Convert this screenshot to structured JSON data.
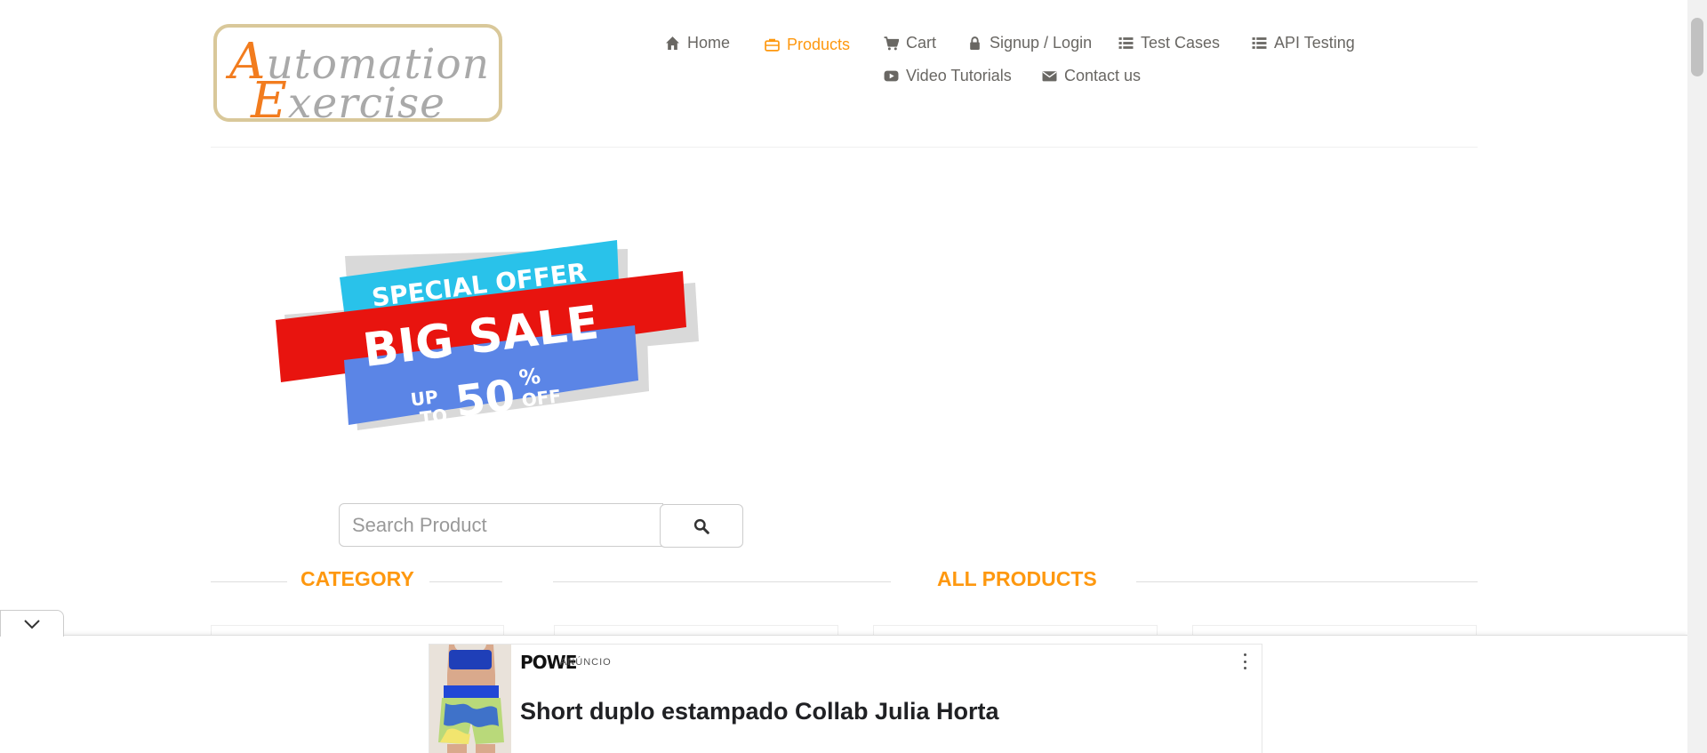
{
  "logo": {
    "line1_first": "A",
    "line1_rest": "utomation",
    "line2_first": "E",
    "line2_rest": "xercise"
  },
  "nav": [
    {
      "label": "Home",
      "icon": "home-icon",
      "active": false
    },
    {
      "label": "Products",
      "icon": "briefcase-icon",
      "active": true
    },
    {
      "label": "Cart",
      "icon": "cart-icon",
      "active": false
    },
    {
      "label": "Signup / Login",
      "icon": "lock-icon",
      "active": false
    },
    {
      "label": "Test Cases",
      "icon": "list-icon",
      "active": false
    },
    {
      "label": "API Testing",
      "icon": "list-icon",
      "active": false
    },
    {
      "label": "Video Tutorials",
      "icon": "youtube-icon",
      "active": false
    },
    {
      "label": "Contact us",
      "icon": "envelope-icon",
      "active": false
    }
  ],
  "banner": {
    "line1": "SPECIAL OFFER",
    "line2": "BIG SALE",
    "up": "UP",
    "to": "TO",
    "percent_value": "50",
    "percent_sign": "%",
    "off": "OFF"
  },
  "search": {
    "placeholder": "Search Product",
    "value": ""
  },
  "sections": {
    "category": "CATEGORY",
    "all_products": "ALL PRODUCTS"
  },
  "ad": {
    "brand": "POWE",
    "label": "ANÚNCIO",
    "title": "Short duplo estampado Collab Julia Horta"
  },
  "colors": {
    "accent": "#fe980f",
    "nav_text": "#696763",
    "banner_blue_light": "#29c2ea",
    "banner_red": "#e8140f",
    "banner_blue": "#5b85e6"
  }
}
